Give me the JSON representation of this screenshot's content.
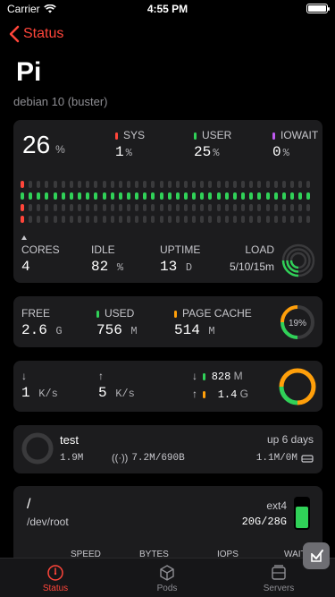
{
  "status_bar": {
    "carrier": "Carrier",
    "time": "4:55 PM"
  },
  "nav": {
    "back_label": "Status"
  },
  "header": {
    "title": "Pi",
    "subtitle": "debian 10 (buster)"
  },
  "cpu": {
    "total": "26",
    "total_unit": "%",
    "sys_label": "SYS",
    "sys_value": "1",
    "sys_unit": "%",
    "user_label": "USER",
    "user_value": "25",
    "user_unit": "%",
    "iowait_label": "IOWAIT",
    "iowait_value": "0",
    "iowait_unit": "%",
    "cores_label": "CORES",
    "cores_value": "4",
    "idle_label": "IDLE",
    "idle_value": "82",
    "idle_unit": "%",
    "uptime_label": "UPTIME",
    "uptime_value": "13",
    "uptime_unit": "D",
    "load_label": "LOAD",
    "load_value": "5/10/15m"
  },
  "memory": {
    "free_label": "FREE",
    "free_value": "2.6",
    "free_unit": "G",
    "used_label": "USED",
    "used_value": "756",
    "used_unit": "M",
    "cache_label": "PAGE CACHE",
    "cache_value": "514",
    "cache_unit": "M",
    "ring_percent": "19%"
  },
  "network": {
    "down_value": "1",
    "down_unit": "K/s",
    "up_value": "5",
    "up_unit": "K/s",
    "total_down_value": "828",
    "total_down_unit": "M",
    "total_up_value": "1.4",
    "total_up_unit": "G"
  },
  "pod": {
    "name": "test",
    "uptime": "up 6 days",
    "memory": "1.9M",
    "network": "7.2M/690B",
    "storage": "1.1M/0M"
  },
  "disk": {
    "mount": "/",
    "device": "/dev/root",
    "fstype": "ext4",
    "usage": "20G/28G",
    "col_speed": "SPEED",
    "col_bytes": "BYTES",
    "col_iops": "IOPS",
    "col_wait": "WAIT"
  },
  "tabs": [
    {
      "label": "Status"
    },
    {
      "label": "Pods"
    },
    {
      "label": "Servers"
    }
  ],
  "colors": {
    "accent": "#ff453a",
    "green": "#30d158",
    "orange": "#ff9f0a",
    "purple": "#bf5af2",
    "card": "#1c1c1e"
  }
}
